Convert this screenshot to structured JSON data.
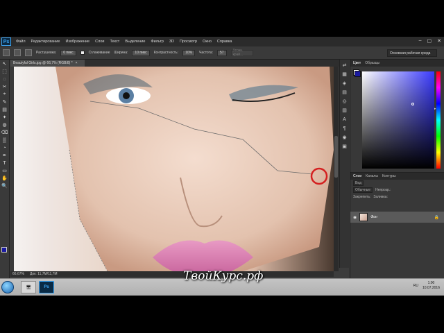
{
  "app": {
    "logo": "Ps"
  },
  "menu": [
    "Файл",
    "Редактирование",
    "Изображение",
    "Слои",
    "Текст",
    "Выделение",
    "Фильтр",
    "3D",
    "Просмотр",
    "Окно",
    "Справка"
  ],
  "window_controls": [
    "–",
    "▢",
    "✕"
  ],
  "options": {
    "feather_label": "Растушевка:",
    "feather_value": "0 пикс",
    "antialias_label": "Сглаживание",
    "width_label": "Ширина:",
    "width_value": "10 пикс",
    "contrast_label": "Контрастность:",
    "contrast_value": "10%",
    "frequency_label": "Частота:",
    "frequency_value": "57",
    "refine_label": "Уточн. край...",
    "workspace": "Основная рабочая среда"
  },
  "document": {
    "tab": "Beautyful Girls.jpg @ 66,7% (RGB/8) *",
    "close": "×"
  },
  "status": {
    "zoom": "66,67%",
    "doc": "Док: 11,7M/11,7M"
  },
  "tools": [
    "↖",
    "⬚",
    "◌",
    "✂",
    "⌖",
    "✎",
    "▤",
    "✦",
    "◍",
    "⌫",
    "▒",
    "◔",
    "✒",
    "T",
    "▭",
    "✋",
    "🔍"
  ],
  "panel_icons": [
    "⇄",
    "▦",
    "◈",
    "▤",
    "◎",
    "▥",
    "A",
    "¶",
    "◉",
    "▣"
  ],
  "color_panel": {
    "tabs": [
      "Цвет",
      "Образцы"
    ],
    "fg": "#1a1aa0",
    "bg": "#ffffff"
  },
  "layers_panel": {
    "tabs": [
      "Слои",
      "Каналы",
      "Контуры"
    ],
    "kind_label": "Вид",
    "blend_mode": "Обычные",
    "opacity_label": "Непрозр.:",
    "lock_label": "Закрепить:",
    "fill_label": "Заливка:",
    "layer_name": "Фон",
    "footer_icons": [
      "⊝",
      "fx",
      "◐",
      "◎",
      "▭",
      "⊞",
      "🗑"
    ]
  },
  "taskbar": {
    "apps": [
      "🖥",
      "Ps"
    ],
    "clock_time": "1:00",
    "clock_date": "10.07.2016",
    "lang": "RU"
  },
  "watermark": "ТвойКурс.рф"
}
